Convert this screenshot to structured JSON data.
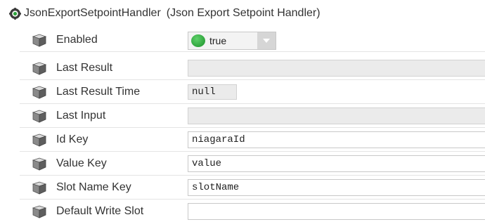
{
  "component": {
    "name": "JsonExportSetpointHandler",
    "display_name": "(Json Export Setpoint Handler)",
    "icon": "component-gear-icon"
  },
  "slots": [
    {
      "label": "Enabled",
      "value": "true",
      "editor": "boolean-select",
      "icon": "property-slot-icon",
      "status_color": "#2ea33c"
    },
    {
      "label": "Last Result",
      "value": "",
      "editor": "readonly-text",
      "icon": "property-slot-icon"
    },
    {
      "label": "Last Result Time",
      "value": "null",
      "editor": "readonly-text",
      "icon": "property-slot-icon"
    },
    {
      "label": "Last Input",
      "value": "",
      "editor": "readonly-text",
      "icon": "property-slot-icon"
    },
    {
      "label": "Id Key",
      "value": "niagaraId",
      "editor": "text",
      "icon": "property-slot-icon"
    },
    {
      "label": "Value Key",
      "value": "value",
      "editor": "text",
      "icon": "property-slot-icon"
    },
    {
      "label": "Slot Name Key",
      "value": "slotName",
      "editor": "text",
      "icon": "property-slot-icon"
    },
    {
      "label": "Default Write Slot",
      "value": "",
      "editor": "text",
      "icon": "property-slot-icon"
    }
  ]
}
